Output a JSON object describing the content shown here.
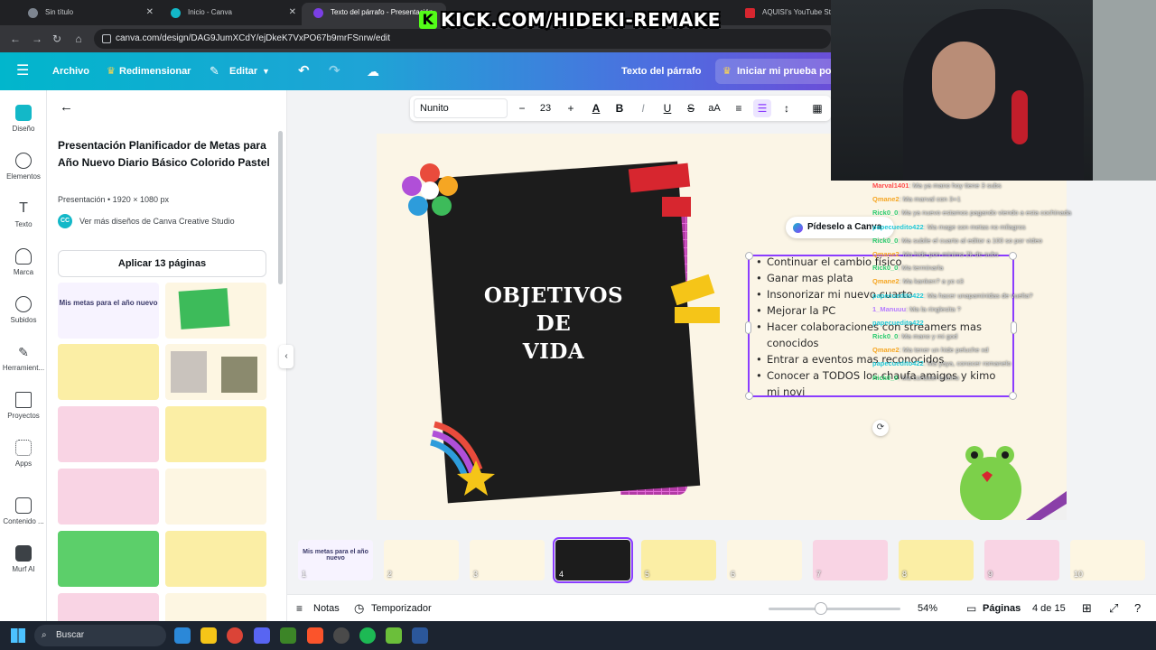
{
  "browser": {
    "tabs": [
      {
        "title": "Sin título",
        "color": "#7d8590"
      },
      {
        "title": "Inicio - Canva",
        "color": "#13b8c8"
      },
      {
        "title": "Texto del párrafo - Presentación",
        "color": "#7b3fe4"
      },
      {
        "title": "AQUISI's YouTube Statis",
        "color": "#d7262f"
      }
    ],
    "url": "canva.com/design/DAG9JumXCdY/ejDkeK7VxPO67b9mrFSnrw/edit",
    "overlay_text": "KICK.COM/HIDEKI-REMAKE"
  },
  "canva_header": {
    "archivo": "Archivo",
    "redimensionar": "Redimensionar",
    "editar": "Editar",
    "doc_name": "Texto del párrafo",
    "trial": "Iniciar mi prueba por"
  },
  "rail": [
    {
      "label": "Diseño"
    },
    {
      "label": "Elementos"
    },
    {
      "label": "Texto"
    },
    {
      "label": "Marca"
    },
    {
      "label": "Subidos"
    },
    {
      "label": "Herramient..."
    },
    {
      "label": "Proyectos"
    },
    {
      "label": "Apps"
    },
    {
      "label": "Contenido ..."
    },
    {
      "label": "Murf AI"
    }
  ],
  "panel": {
    "title": "Presentación Planificador de Metas para Año Nuevo Diario Básico Colorido Pastel",
    "subtitle": "Presentación • 1920 × 1080 px",
    "more_designs": "Ver más diseños de Canva Creative Studio",
    "cc_badge": "CC",
    "apply_button": "Aplicar 13 páginas",
    "thumb1_title": "Mis metas para el año nuevo"
  },
  "toolbar": {
    "font": "Nunito",
    "size": "23"
  },
  "slide": {
    "title_line1": "OBJETIVOS",
    "title_line2": "DE",
    "title_line3": "VIDA",
    "ask_canva": "Pídeselo a Canva",
    "goals": [
      "Continuar el cambio físico",
      "Ganar mas plata",
      "Insonorizar mi nuevo cuarto",
      "Mejorar la PC",
      "Hacer colaboraciones con streamers mas conocidos",
      "Entrar a eventos mas reconocidos",
      "Conocer a TODOS los chaufa amigos y kimo mi novi"
    ]
  },
  "chat": [
    {
      "user": "Marval1401",
      "msg": ": Ma ya mano hoy tiene 3 subs",
      "color": "#ff4d4d"
    },
    {
      "user": "Qmane2",
      "msg": ": Ma marval con 3+1",
      "color": "#f5a623"
    },
    {
      "user": "Rick0_0",
      "msg": ": Ma ya nuevo estamos pagando viendo a esta cochinada",
      "color": "#2ecc71"
    },
    {
      "user": "papecuedito422",
      "msg": ": Ma mage son metas no milagros",
      "color": "#22c8d8"
    },
    {
      "user": "Rick0_0",
      "msg": ": Ma subile el cuarto al editor a 100 so por video",
      "color": "#2ecc71"
    },
    {
      "user": "Qmane2",
      "msg": ": Ma hide pon minimo 2k de subs",
      "color": "#f5a623"
    },
    {
      "user": "Rick0_0",
      "msg": ": Ma terminarla",
      "color": "#2ecc71"
    },
    {
      "user": "Qmane2",
      "msg": ": Ma kanken? a yo x3",
      "color": "#f5a623"
    },
    {
      "user": "papecuedito422",
      "msg": ": Ma hacer unapaminidas de vuelta?",
      "color": "#22c8d8"
    },
    {
      "user": "1_Manuuu",
      "msg": ": Ma la ringlesita ?",
      "color": "#b57cff"
    },
    {
      "user": "papecuedito422",
      "msg": "",
      "color": "#22c8d8"
    },
    {
      "user": "Rick0_0",
      "msg": ": Ma mano y mi god",
      "color": "#2ecc71"
    },
    {
      "user": "Qmane2",
      "msg": ": Ma tener un hide peluche xd",
      "color": "#f5a623"
    },
    {
      "user": "papecuedito422",
      "msg": ": Ma yaya, conocer romanelo",
      "color": "#22c8d8"
    },
    {
      "user": "Rick0_0",
      "msg": ": Ma conocer a kimo",
      "color": "#2ecc71"
    }
  ],
  "pages": [
    {
      "num": "1",
      "title": "Mis metas para el año nuevo"
    },
    {
      "num": "2"
    },
    {
      "num": "3"
    },
    {
      "num": "4"
    },
    {
      "num": "5"
    },
    {
      "num": "6"
    },
    {
      "num": "7"
    },
    {
      "num": "8"
    },
    {
      "num": "9"
    },
    {
      "num": "10"
    }
  ],
  "bottom": {
    "notes": "Notas",
    "timer": "Temporizador",
    "zoom": "54%",
    "zoom_fraction": 0.4,
    "pages_label": "Páginas",
    "page_count": "4 de 15"
  },
  "taskbar": {
    "search": "Buscar"
  },
  "colors": {
    "accent": "#8b3dff",
    "teal": "#13b8c8"
  }
}
